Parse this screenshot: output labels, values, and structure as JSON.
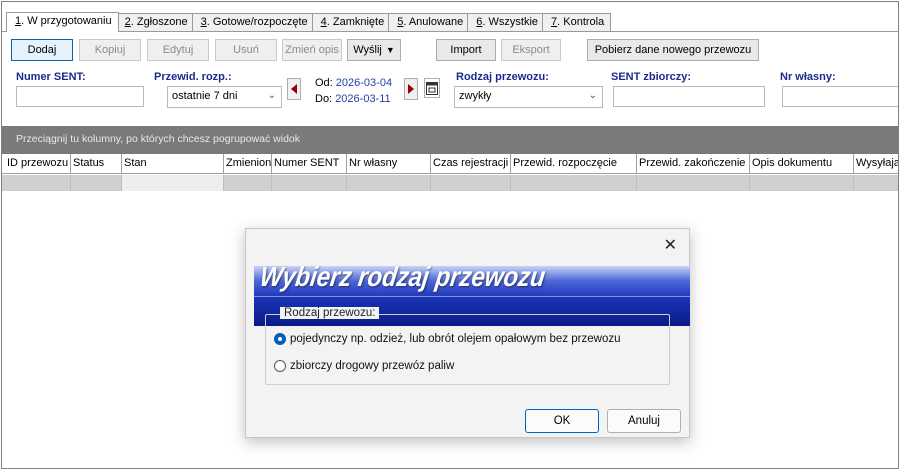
{
  "tabs": [
    {
      "key": "1",
      "label": ". W przygotowaniu"
    },
    {
      "key": "2",
      "label": ". Zgłoszone"
    },
    {
      "key": "3",
      "label": ". Gotowe/rozpoczęte"
    },
    {
      "key": "4",
      "label": ". Zamknięte"
    },
    {
      "key": "5",
      "label": ". Anulowane"
    },
    {
      "key": "6",
      "label": ". Wszystkie"
    },
    {
      "key": "7",
      "label": ". Kontrola"
    }
  ],
  "toolbar": {
    "add": "Dodaj",
    "copy": "Kopiuj",
    "edit": "Edytuj",
    "delete": "Usuń",
    "change_desc": "Zmień opis",
    "send": "Wyślij",
    "import": "Import",
    "export": "Eksport",
    "fetch": "Pobierz dane nowego przewozu"
  },
  "filters": {
    "sent_label": "Numer SENT:",
    "sent_value": "",
    "start_label": "Przewid. rozp.:",
    "start_value": "ostatnie 7 dni",
    "from_prefix": "Od:",
    "from_date": "2026-03-04",
    "to_prefix": "Do:",
    "to_date": "2026-03-11",
    "transport_label": "Rodzaj przewozu:",
    "transport_value": "zwykły",
    "collective_label": "SENT zbiorczy:",
    "collective_value": "",
    "own_label": "Nr własny:",
    "own_value": ""
  },
  "grid": {
    "group_hint": "Przeciągnij tu kolumny, po których chcesz pogrupować widok",
    "columns": [
      "ID przewozu",
      "Status",
      "Stan",
      "Zmieniony",
      "Numer SENT",
      "Nr własny",
      "Czas rejestracji",
      "Przewid. rozpoczęcie",
      "Przewid. zakończenie",
      "Opis dokumentu",
      "Wysyłający"
    ]
  },
  "dialog": {
    "title": "Wybierz rodzaj przewozu",
    "group_label": "Rodzaj przewozu:",
    "option_single": "pojedynczy np. odzież, lub obrót olejem opałowym bez przewozu",
    "option_collective": "zbiorczy drogowy przewóz paliw",
    "selected": "single",
    "ok": "OK",
    "cancel": "Anuluj"
  },
  "colors": {
    "accent": "#0067c0",
    "label_blue": "#1b2a8f",
    "banner": "#1a33b5",
    "groupbar": "#7a7a7a"
  }
}
